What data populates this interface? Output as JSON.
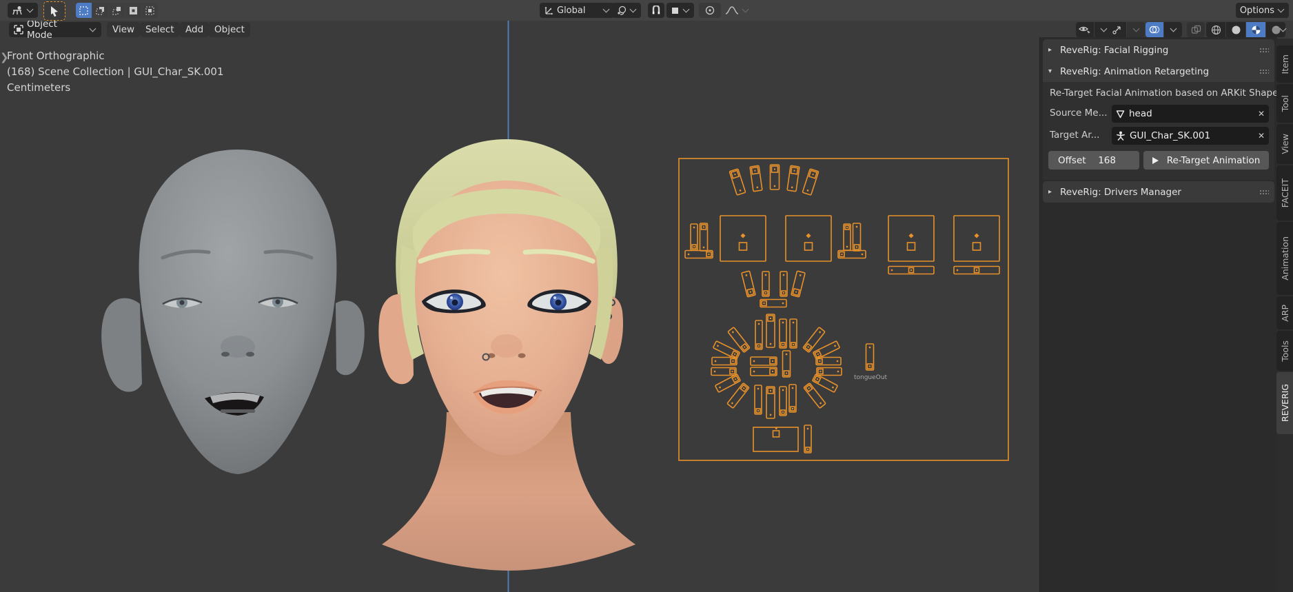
{
  "topbar": {
    "orientation_label": "Global",
    "options_label": "Options"
  },
  "header": {
    "mode_label": "Object Mode",
    "menu_view": "View",
    "menu_select": "Select",
    "menu_add": "Add",
    "menu_object": "Object"
  },
  "viewport": {
    "line1": "Front Orthographic",
    "line2": "(168) Scene Collection | GUI_Char_SK.001",
    "line3": "Centimeters",
    "axis_color": "#5378b5"
  },
  "rig": {
    "tongue_label": "tongueOut",
    "accent_color": "#e8912a"
  },
  "sidebar": {
    "panel_facial": "ReveRig: Facial Rigging",
    "panel_retarget": "ReveRig: Animation Retargeting",
    "panel_drivers": "ReveRig: Drivers Manager",
    "description": "Re-Target Facial Animation based on ARKit Shape",
    "source_label": "Source Me...",
    "source_value": "head",
    "target_label": "Target Ar...",
    "target_value": "GUI_Char_SK.001",
    "offset_label": "Offset",
    "offset_value": "168",
    "retarget_button": "Re-Target Animation",
    "tabs": [
      {
        "label": "Item"
      },
      {
        "label": "Tool"
      },
      {
        "label": "View"
      },
      {
        "label": "FACEIT"
      },
      {
        "label": "Animation"
      },
      {
        "label": "ARP"
      },
      {
        "label": "Tools"
      },
      {
        "label": "REVERIG"
      }
    ]
  }
}
